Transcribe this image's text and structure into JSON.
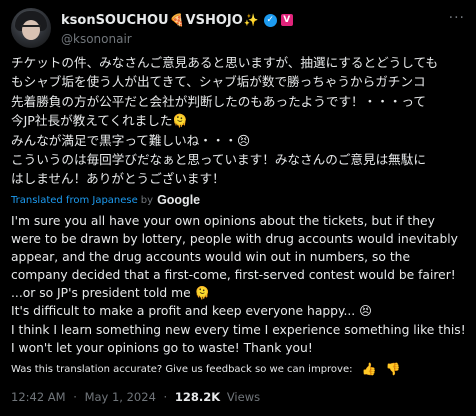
{
  "author": {
    "display_name": "ksonSOUCHOU",
    "name_emoji_1": "🍕",
    "display_name_2": "VSHOJO",
    "name_emoji_2": "✨",
    "verified_glyph": "✓",
    "affiliation_glyph": "V",
    "handle": "@ksononair"
  },
  "more_label": "···",
  "original_lines": [
    "チケットの件、みなさんご意見あると思いますが、抽選にするとどうしても",
    "もシャブ垢を使う人が出てきて、シャブ垢が数で勝っちゃうからガチンコ",
    "先着勝負の方が公平だと会社が判断したのもあったようです！・・・って",
    "今JP社長が教えてくれました🫠",
    "みんなが満足で黒字って難しいね・・・😣",
    "こういうのは毎回学びだなぁと思っています！みなさんのご意見は無駄に",
    "はしません！ありがとうございます！"
  ],
  "translation": {
    "label": "Translated from Japanese",
    "by": "by",
    "provider": "Google"
  },
  "translated_lines": [
    "I'm sure you all have your own opinions about the tickets, but if they",
    "were to be drawn by lottery, people with drug accounts would inevitably",
    "appear, and the drug accounts would win out in numbers, so the",
    "company decided that a first-come, first-served contest would be fairer!",
    "...or so JP's president told me 🫠",
    "It's difficult to make a profit and keep everyone happy... 😣",
    "I think I learn something new every time I experience something like this!",
    "I won't let your opinions go to waste! Thank you!"
  ],
  "feedback": {
    "text": "Was this translation accurate? Give us feedback so we can improve:",
    "thumbs_up": "👍",
    "thumbs_down": "👎"
  },
  "meta": {
    "time": "12:42 AM",
    "sep1": "·",
    "date": "May 1, 2024",
    "sep2": "·",
    "views_count": "128.2K",
    "views_label": "Views"
  },
  "colors": {
    "background": "#000000",
    "text": "#e7e9ea",
    "muted": "#71767b",
    "link": "#1d9bf0",
    "verified": "#1d9bf0",
    "affiliation": "#e0247b"
  }
}
